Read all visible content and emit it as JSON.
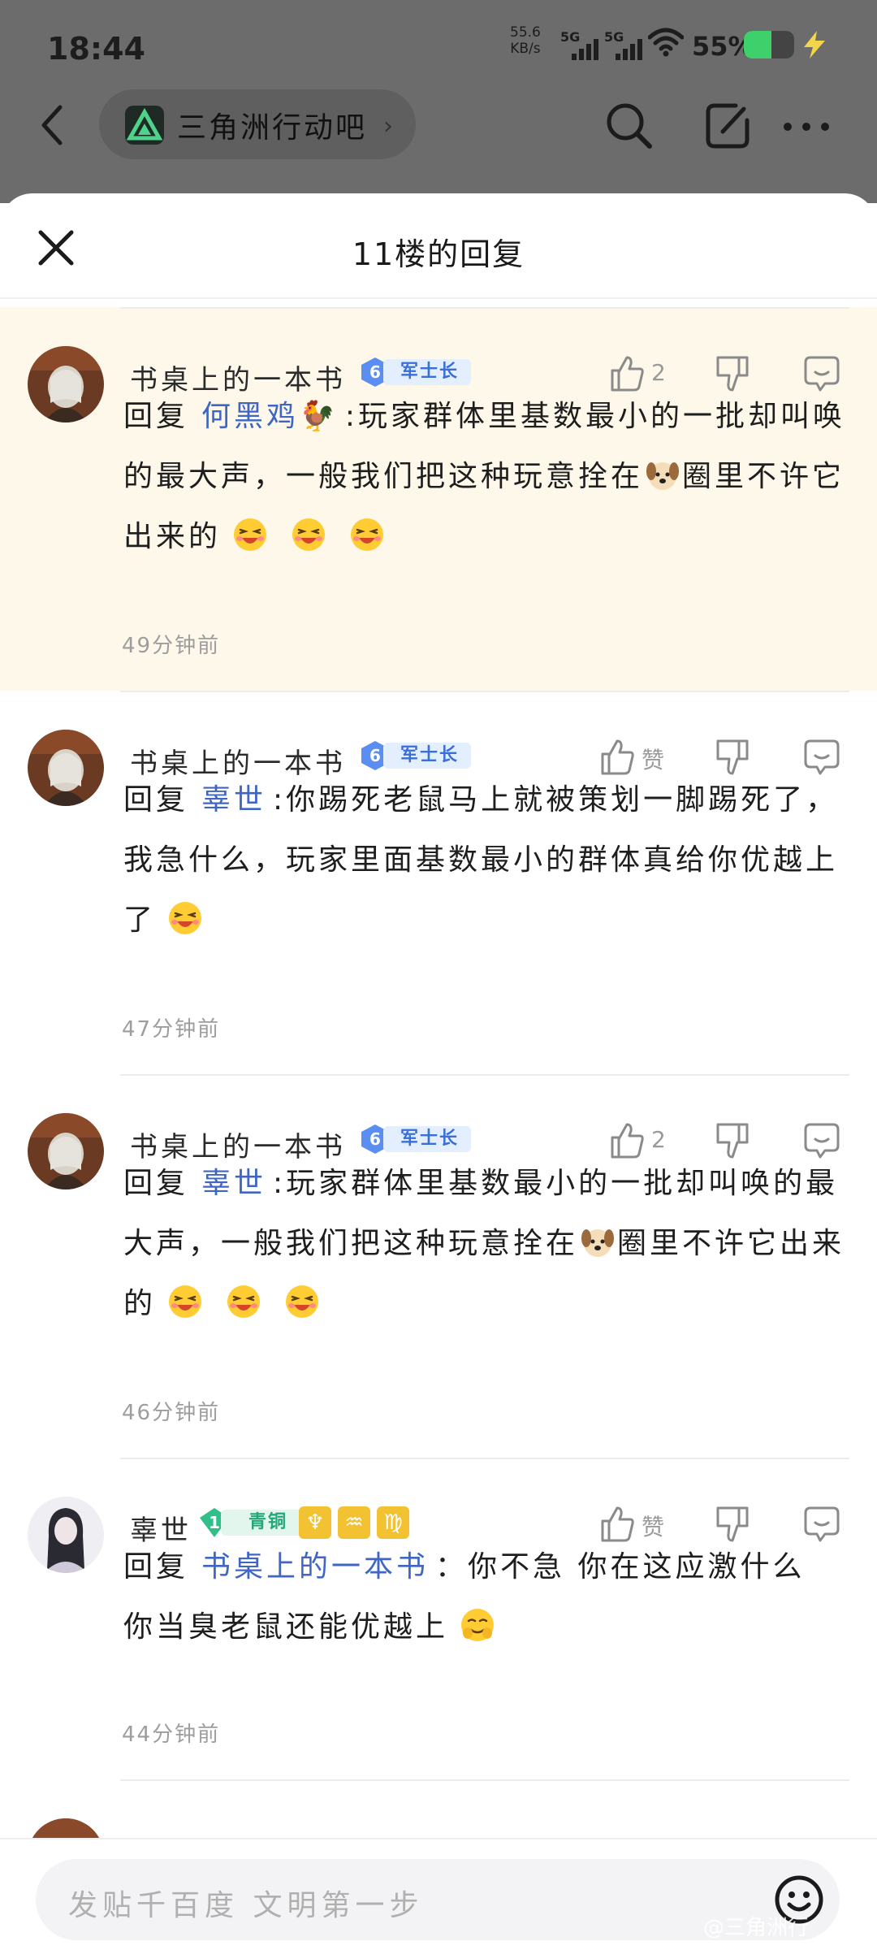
{
  "status_bar": {
    "time": "18:44",
    "net_speed_value": "55.6",
    "net_speed_unit": "KB/s",
    "sim1": "5G",
    "sim2": "5G",
    "battery_percent": "55%",
    "battery_level": 0.55
  },
  "nav": {
    "forum_name": "三角洲行动吧",
    "forum_chevron": "›"
  },
  "sheet": {
    "title": "11楼的回复"
  },
  "comments": [
    {
      "username": "书桌上的一本书",
      "level": "6",
      "rank_title": "军士长",
      "like_label": "2",
      "prefix": "回复",
      "mention": "何黑鸡🐓",
      "text_1": ":玩家群体里基数最小的一批却叫唤的最大声，一般我们把这种玩意拴在",
      "text_2": "圈里不许它出来的",
      "time": "49分钟前"
    },
    {
      "username": "书桌上的一本书",
      "level": "6",
      "rank_title": "军士长",
      "like_label": "赞",
      "prefix": "回复",
      "mention": "辜世",
      "text_1": ":你踢死老鼠马上就被策划一脚踢死了，我急什么，玩家里面基数最小的群体真给你优越上了",
      "time": "47分钟前"
    },
    {
      "username": "书桌上的一本书",
      "level": "6",
      "rank_title": "军士长",
      "like_label": "2",
      "prefix": "回复",
      "mention": "辜世",
      "text_1": ":玩家群体里基数最小的一批却叫唤的最大声，一般我们把这种玩意拴在",
      "text_2": "圈里不许它出来的",
      "time": "46分钟前"
    },
    {
      "username": "辜世",
      "level": "1",
      "rank_title": "青铜",
      "zodiac": [
        "♆",
        "♒",
        "♍"
      ],
      "like_label": "赞",
      "prefix": "回复",
      "mention": "书桌上的一本书",
      "text_1": "：你不急 你在这应激什么 你当臭老鼠还能优越上",
      "time": "44分钟前"
    }
  ],
  "composer": {
    "placeholder": "发贴千百度 文明第一步"
  },
  "watermark": "@三角洲行"
}
